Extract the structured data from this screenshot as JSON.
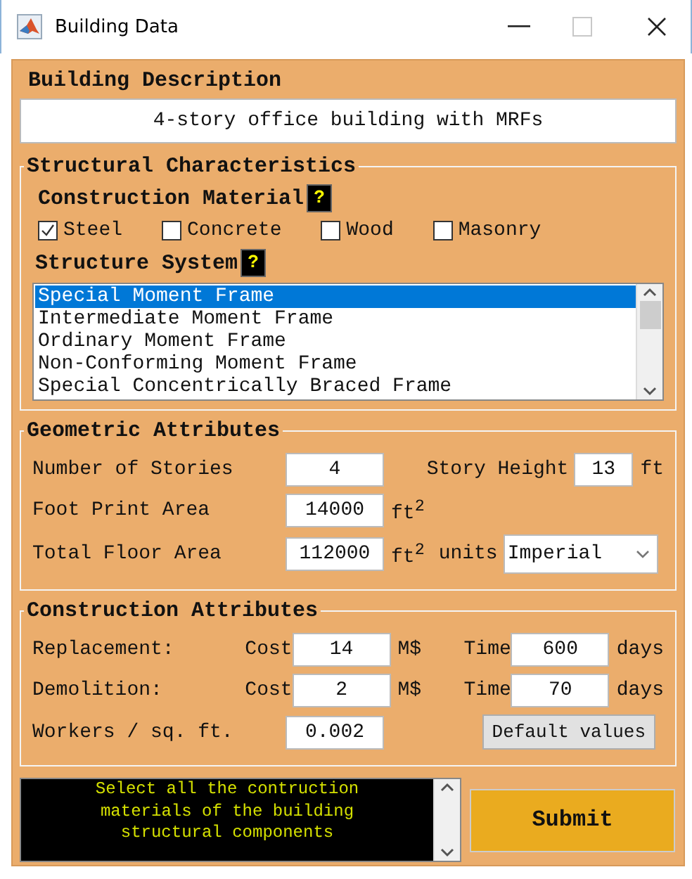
{
  "window": {
    "title": "Building Data"
  },
  "building_description": {
    "heading": "Building Description",
    "value": "4-story office building with MRFs"
  },
  "structural_characteristics": {
    "title": "Structural Characteristics",
    "construction_material": {
      "label": "Construction Material",
      "help": "?",
      "options": [
        {
          "label": "Steel",
          "checked": true
        },
        {
          "label": "Concrete",
          "checked": false
        },
        {
          "label": "Wood",
          "checked": false
        },
        {
          "label": "Masonry",
          "checked": false
        }
      ]
    },
    "structure_system": {
      "label": "Structure System",
      "help": "?",
      "items": [
        {
          "label": "Special Moment Frame",
          "selected": true
        },
        {
          "label": "Intermediate Moment Frame",
          "selected": false
        },
        {
          "label": "Ordinary Moment Frame",
          "selected": false
        },
        {
          "label": "Non-Conforming Moment Frame",
          "selected": false
        },
        {
          "label": "Special Concentrically Braced Frame",
          "selected": false
        }
      ]
    }
  },
  "geometric_attributes": {
    "title": "Geometric Attributes",
    "number_of_stories": {
      "label": "Number of Stories",
      "value": "4"
    },
    "story_height": {
      "label": "Story Height",
      "value": "13",
      "unit": "ft"
    },
    "foot_print_area": {
      "label": "Foot Print Area",
      "value": "14000",
      "unit": "ft$^{2}$"
    },
    "total_floor_area": {
      "label": "Total Floor Area",
      "value": "112000",
      "unit": "ft$^{2}$"
    },
    "units": {
      "label": "units",
      "value": "Imperial"
    }
  },
  "construction_attributes": {
    "title": "Construction Attributes",
    "rows": [
      {
        "label": "Replacement:",
        "cost_label": "Cost",
        "cost": "14",
        "cost_unit": "M$",
        "time_label": "Time",
        "time": "600",
        "time_unit": "days"
      },
      {
        "label": "Demolition:",
        "cost_label": "Cost",
        "cost": "2",
        "cost_unit": "M$",
        "time_label": "Time",
        "time": "70",
        "time_unit": "days"
      }
    ],
    "workers": {
      "label": "Workers / sq. ft.",
      "value": "0.002"
    },
    "default_button": "Default values"
  },
  "message": "Select all the contruction materials of the building structural components",
  "submit": "Submit"
}
